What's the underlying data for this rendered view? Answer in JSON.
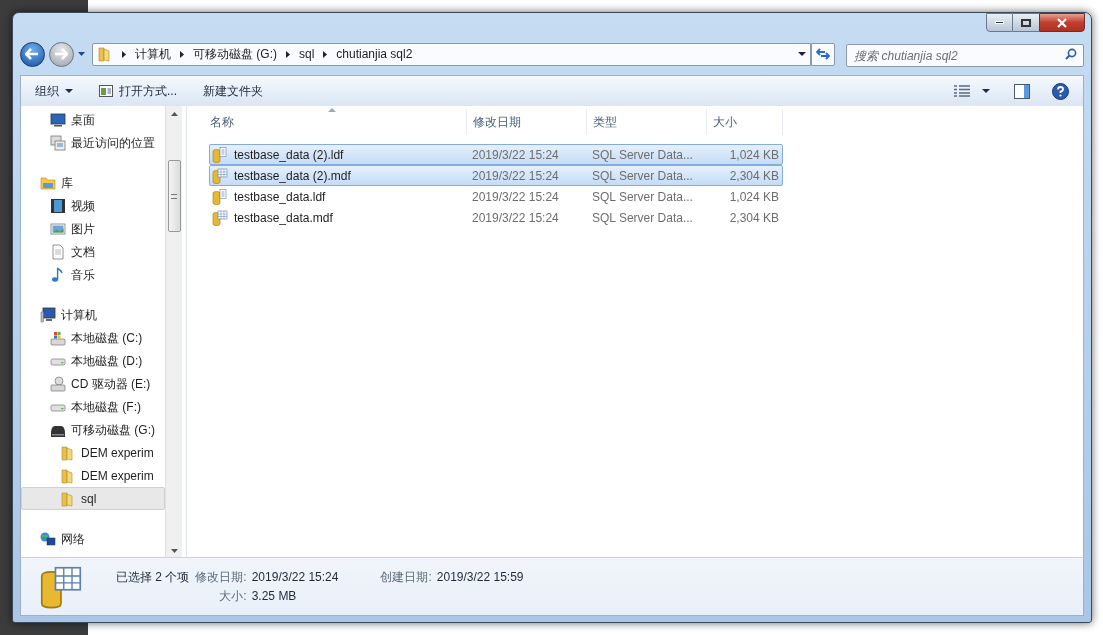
{
  "address": {
    "crumbs": [
      "计算机",
      "可移动磁盘 (G:)",
      "sql",
      "chutianjia sql2"
    ]
  },
  "search": {
    "placeholder": "搜索 chutianjia sql2"
  },
  "toolbar": [
    {
      "label": "组织",
      "kind": "menu"
    },
    {
      "label": "打开方式...",
      "kind": "open"
    },
    {
      "label": "新建文件夹",
      "kind": "plain"
    }
  ],
  "nav": [
    {
      "label": "桌面",
      "kind": "desktop",
      "selected": false
    },
    {
      "label": "最近访问的位置",
      "kind": "recent",
      "selected": false
    },
    {
      "label": "库",
      "kind": "library",
      "selected": false,
      "children": [
        {
          "label": "视频",
          "kind": "video",
          "selected": false
        },
        {
          "label": "图片",
          "kind": "picture",
          "selected": false
        },
        {
          "label": "文档",
          "kind": "document",
          "selected": false
        },
        {
          "label": "音乐",
          "kind": "music",
          "selected": false
        }
      ]
    },
    {
      "label": "计算机",
      "kind": "computer",
      "selected": false,
      "children": [
        {
          "label": "本地磁盘 (C:)",
          "kind": "system-disk",
          "selected": false
        },
        {
          "label": "本地磁盘 (D:)",
          "kind": "disk",
          "selected": false
        },
        {
          "label": "CD 驱动器 (E:)",
          "kind": "cd",
          "selected": false
        },
        {
          "label": "本地磁盘 (F:)",
          "kind": "disk",
          "selected": false
        },
        {
          "label": "可移动磁盘 (G:)",
          "kind": "removable",
          "selected": false,
          "children": [
            {
              "label": "DEM experim",
              "kind": "folder",
              "selected": false
            },
            {
              "label": "DEM experim",
              "kind": "folder",
              "selected": false
            },
            {
              "label": "sql",
              "kind": "folder",
              "selected": true
            }
          ]
        }
      ]
    },
    {
      "label": "网络",
      "kind": "network",
      "selected": false
    }
  ],
  "files": {
    "columns": [
      "名称",
      "修改日期",
      "类型",
      "大小"
    ],
    "rows": [
      {
        "name": "testbase_data (2).ldf",
        "date": "2019/3/22 15:24",
        "type": "SQL Server Data...",
        "size": "1,024 KB",
        "kind": "ldf",
        "selected": true
      },
      {
        "name": "testbase_data (2).mdf",
        "date": "2019/3/22 15:24",
        "type": "SQL Server Data...",
        "size": "2,304 KB",
        "kind": "mdf",
        "selected": true
      },
      {
        "name": "testbase_data.ldf",
        "date": "2019/3/22 15:24",
        "type": "SQL Server Data...",
        "size": "1,024 KB",
        "kind": "ldf",
        "selected": false
      },
      {
        "name": "testbase_data.mdf",
        "date": "2019/3/22 15:24",
        "type": "SQL Server Data...",
        "size": "2,304 KB",
        "kind": "mdf",
        "selected": false
      }
    ]
  },
  "status": {
    "selection": "已选择 2 个项",
    "modified": {
      "label": "修改日期:",
      "value": "2019/3/22 15:24"
    },
    "created": {
      "label": "创建日期:",
      "value": "2019/3/22 15:59"
    },
    "size": {
      "label": "大小:",
      "value": "3.25 MB"
    }
  }
}
